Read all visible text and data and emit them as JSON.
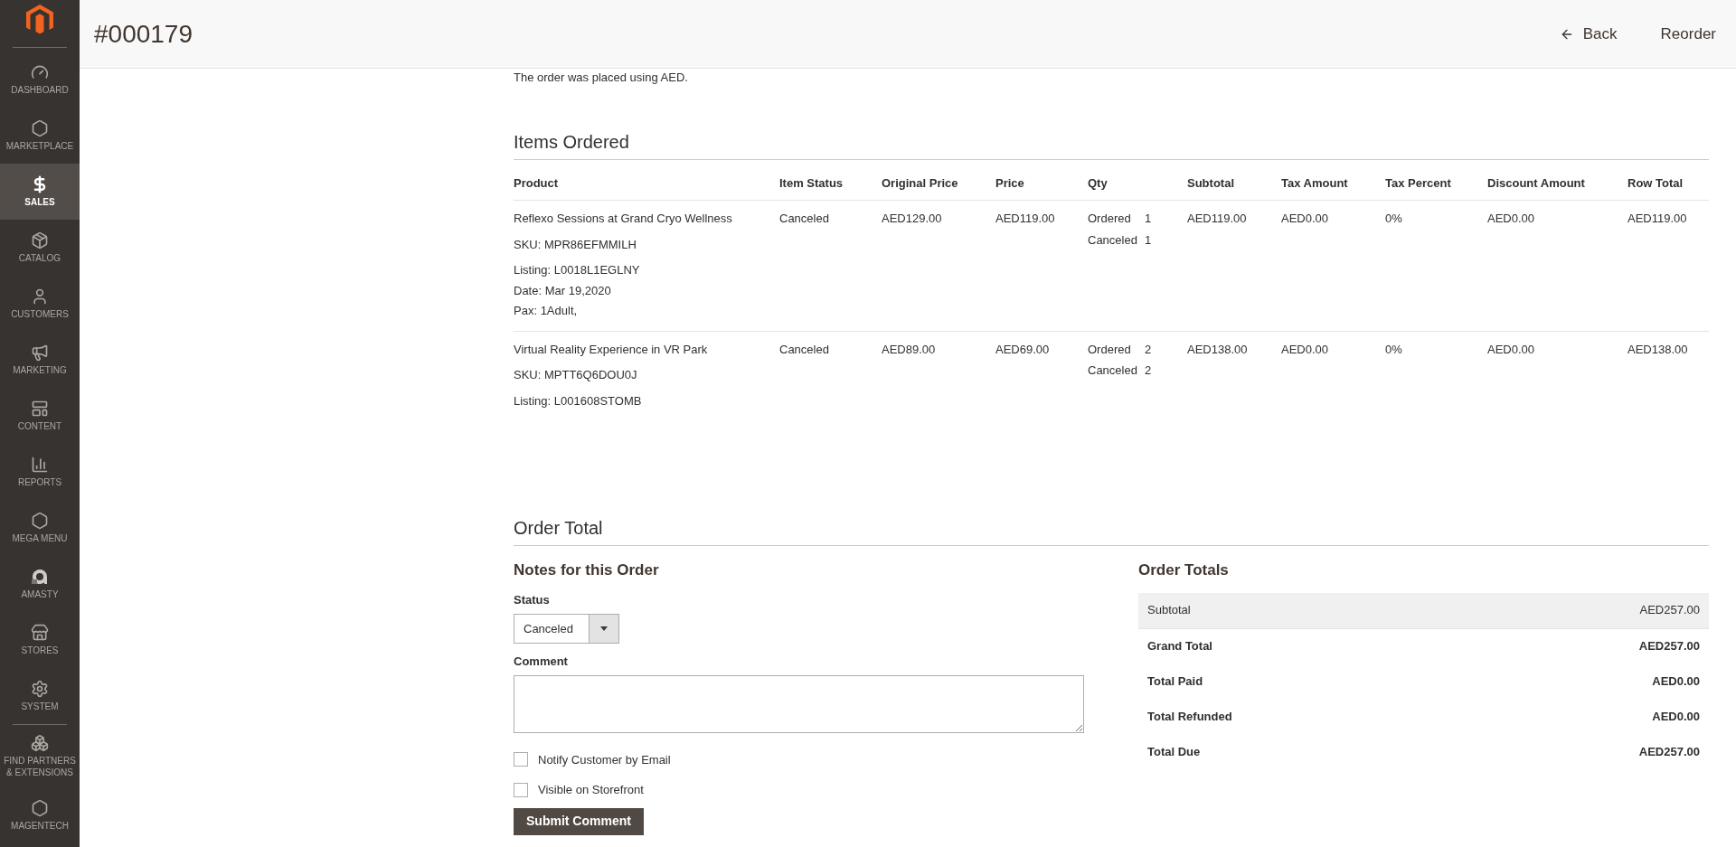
{
  "sidebar": {
    "items": [
      {
        "label": "DASHBOARD",
        "kind": "gauge",
        "selected": false
      },
      {
        "label": "MARKETPLACE",
        "kind": "hexagon",
        "selected": false
      },
      {
        "label": "SALES",
        "kind": "dollar",
        "selected": true
      },
      {
        "label": "CATALOG",
        "kind": "box",
        "selected": false
      },
      {
        "label": "CUSTOMERS",
        "kind": "person",
        "selected": false
      },
      {
        "label": "MARKETING",
        "kind": "megaphone",
        "selected": false
      },
      {
        "label": "CONTENT",
        "kind": "layout",
        "selected": false
      },
      {
        "label": "REPORTS",
        "kind": "bars",
        "selected": false
      },
      {
        "label": "MEGA MENU",
        "kind": "hexagon",
        "selected": false
      },
      {
        "label": "AMASTY",
        "kind": "letter",
        "selected": false
      },
      {
        "label": "STORES",
        "kind": "store",
        "selected": false
      },
      {
        "label": "SYSTEM",
        "kind": "gear",
        "selected": false
      },
      {
        "label": "FIND PARTNERS & EXTENSIONS",
        "kind": "blocks",
        "selected": false
      },
      {
        "label": "MAGENTECH",
        "kind": "hexagon",
        "selected": false
      }
    ]
  },
  "header": {
    "title": "#000179",
    "back": "Back",
    "reorder": "Reorder"
  },
  "currency_note": "The order was placed using AED.",
  "items_ordered": {
    "title": "Items Ordered",
    "columns": [
      "Product",
      "Item Status",
      "Original Price",
      "Price",
      "Qty",
      "Subtotal",
      "Tax Amount",
      "Tax Percent",
      "Discount Amount",
      "Row Total"
    ],
    "rows": [
      {
        "product": "Reflexo Sessions at Grand Cryo Wellness",
        "sku": "SKU: MPR86EFMMILH",
        "options": [
          {
            "label": "Listing:",
            "value": "L0018L1EGLNY"
          },
          {
            "label": "Date:",
            "value": "Mar 19,2020"
          },
          {
            "label": "Pax:",
            "value": "1Adult,"
          }
        ],
        "status": "Canceled",
        "original_price": "AED129.00",
        "price": "AED119.00",
        "qty": [
          {
            "label": "Ordered",
            "value": "1"
          },
          {
            "label": "Canceled",
            "value": "1"
          }
        ],
        "subtotal": "AED119.00",
        "tax_amount": "AED0.00",
        "tax_percent": "0%",
        "discount": "AED0.00",
        "row_total": "AED119.00"
      },
      {
        "product": "Virtual Reality Experience in VR Park",
        "sku": "SKU: MPTT6Q6DOU0J",
        "options": [
          {
            "label": "Listing:",
            "value": "L001608STOMB"
          }
        ],
        "status": "Canceled",
        "original_price": "AED89.00",
        "price": "AED69.00",
        "qty": [
          {
            "label": "Ordered",
            "value": "2"
          },
          {
            "label": "Canceled",
            "value": "2"
          }
        ],
        "subtotal": "AED138.00",
        "tax_amount": "AED0.00",
        "tax_percent": "0%",
        "discount": "AED0.00",
        "row_total": "AED138.00"
      }
    ]
  },
  "order_total": {
    "title": "Order Total",
    "notes": {
      "title": "Notes for this Order",
      "status_label": "Status",
      "status_value": "Canceled",
      "comment_label": "Comment",
      "checkboxes": [
        {
          "label": "Notify Customer by Email",
          "checked": false
        },
        {
          "label": "Visible on Storefront",
          "checked": false
        }
      ],
      "submit": "Submit Comment"
    },
    "totals": {
      "title": "Order Totals",
      "rows": [
        {
          "label": "Subtotal",
          "value": "AED257.00",
          "kind": "plain"
        },
        {
          "label": "Grand Total",
          "value": "AED257.00",
          "kind": "strong"
        },
        {
          "label": "Total Paid",
          "value": "AED0.00",
          "kind": "strong"
        },
        {
          "label": "Total Refunded",
          "value": "AED0.00",
          "kind": "strong"
        },
        {
          "label": "Total Due",
          "value": "AED257.00",
          "kind": "strong"
        }
      ]
    }
  }
}
